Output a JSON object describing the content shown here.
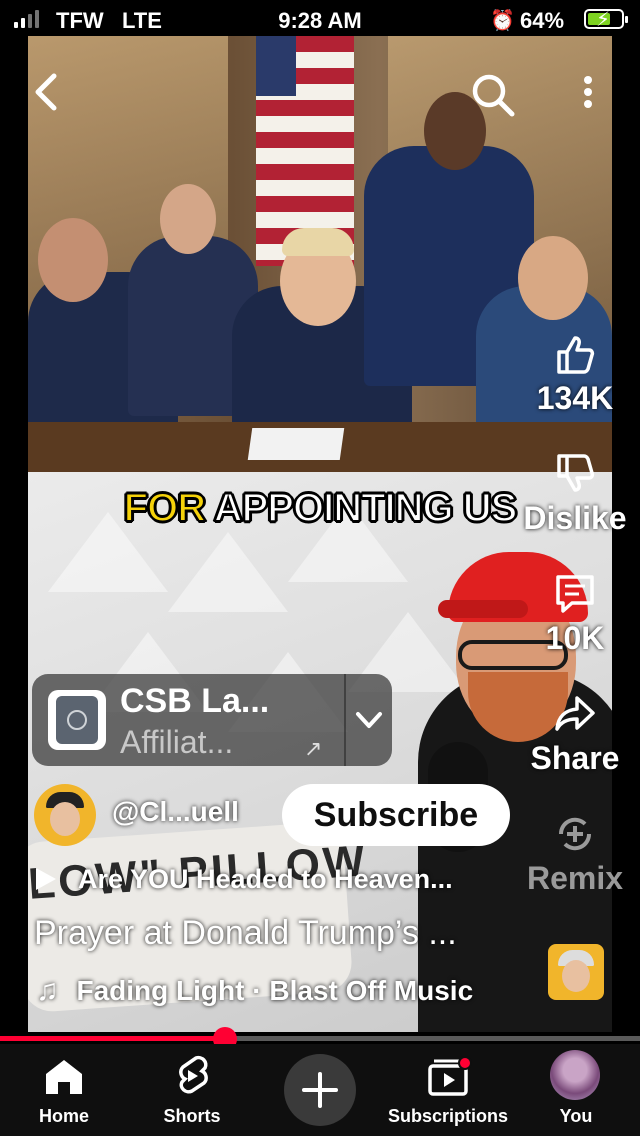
{
  "status_bar": {
    "carrier": "TFW",
    "network": "LTE",
    "time": "9:28 AM",
    "battery": "64%",
    "signal_bars": 4,
    "signal_bars_active": 2,
    "battery_level": 0.64,
    "icons": [
      "alarm-icon",
      "battery-charging-icon"
    ]
  },
  "video": {
    "caption_highlight": "FOR",
    "caption_rest": "APPOINTING US",
    "overlay_text": "LOW\" PILLOW",
    "icons": [
      "back-icon",
      "search-icon",
      "more-icon"
    ]
  },
  "actions": {
    "like_count": "134K",
    "dislike_label": "Dislike",
    "comments_count": "10K",
    "share_label": "Share",
    "remix_label": "Remix",
    "icons": [
      "thumbs-up-icon",
      "thumbs-down-icon",
      "comment-icon",
      "share-icon",
      "remix-icon"
    ]
  },
  "product": {
    "title": "CSB La...",
    "subtitle": "Affiliat...",
    "icons": [
      "external-link-icon",
      "chevron-down-icon"
    ]
  },
  "channel": {
    "handle": "@Cl...uell",
    "subscribe_label": "Subscribe"
  },
  "playlist": {
    "label": "Are YOU Headed to Heaven..."
  },
  "video_title": "Prayer at Donald Trump’s ...",
  "music": {
    "label": "Fading Light · Blast Off Music",
    "icon": "music-note-icon"
  },
  "progress": {
    "fraction": 0.352
  },
  "bottom_nav": {
    "home": "Home",
    "shorts": "Shorts",
    "subscriptions": "Subscriptions",
    "you": "You",
    "icons": [
      "home-icon",
      "shorts-icon",
      "create-icon",
      "subscriptions-icon",
      "avatar"
    ]
  },
  "colors": {
    "accent_red": "#ff0033",
    "caption_yellow": "#f5d20a",
    "battery_green": "#7ed321"
  }
}
